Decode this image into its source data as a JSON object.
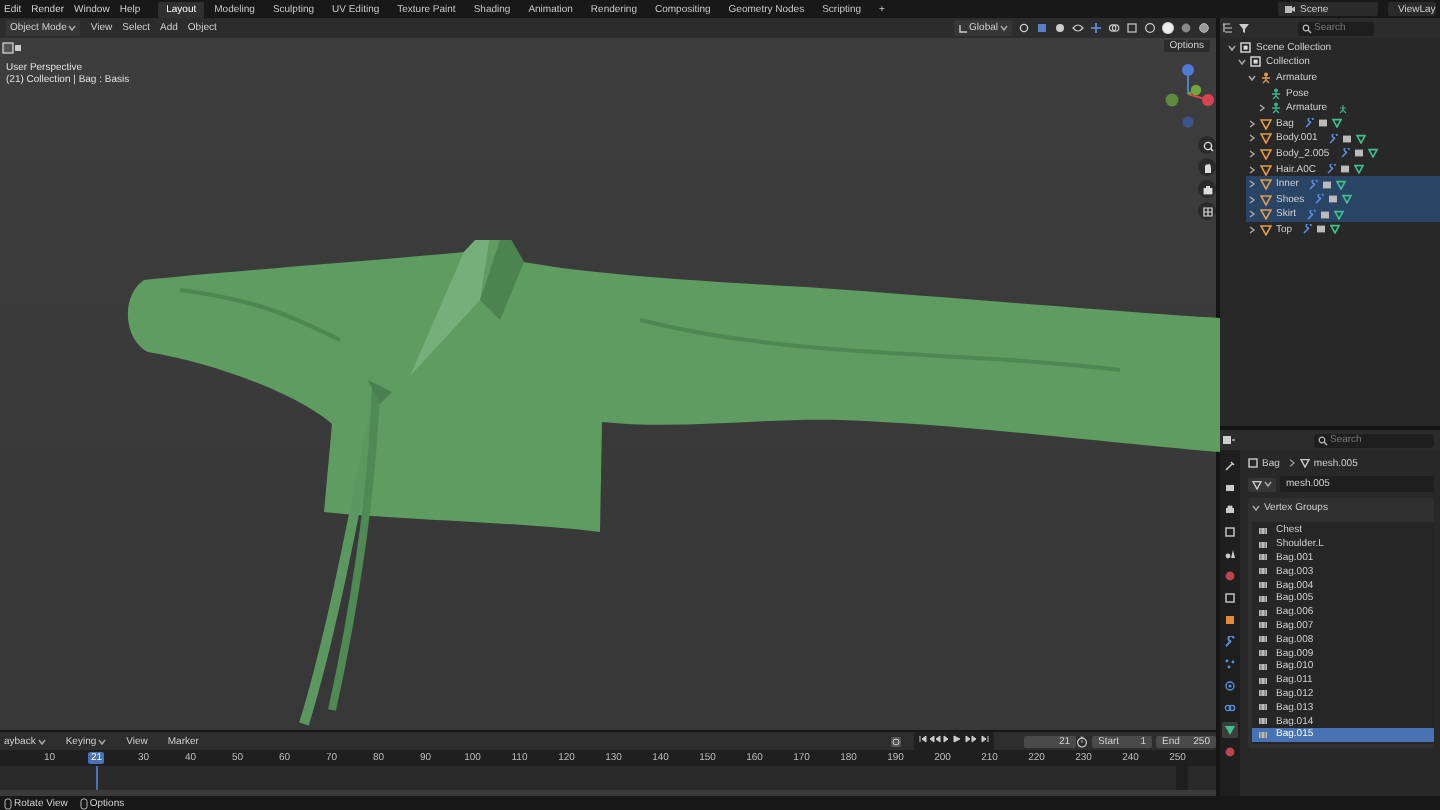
{
  "top_bar": {
    "menus": [
      "Edit",
      "Render",
      "Window",
      "Help"
    ],
    "workspaces": [
      {
        "label": "Layout",
        "selected": true
      },
      {
        "label": "Modeling",
        "selected": false
      },
      {
        "label": "Sculpting",
        "selected": false
      },
      {
        "label": "UV Editing",
        "selected": false
      },
      {
        "label": "Texture Paint",
        "selected": false
      },
      {
        "label": "Shading",
        "selected": false
      },
      {
        "label": "Animation",
        "selected": false
      },
      {
        "label": "Rendering",
        "selected": false
      },
      {
        "label": "Compositing",
        "selected": false
      },
      {
        "label": "Geometry Nodes",
        "selected": false
      },
      {
        "label": "Scripting",
        "selected": false
      }
    ],
    "add_workspace": "+",
    "scene": "Scene",
    "view_layer": "ViewLay"
  },
  "viewport": {
    "header": {
      "mode": "Object Mode",
      "menus": [
        "View",
        "Select",
        "Add",
        "Object"
      ],
      "orientation": "Global"
    },
    "options": "Options",
    "overlay_lines": [
      "User Perspective",
      "(21) Collection | Bag : Basis"
    ]
  },
  "outliner": {
    "search": {
      "placeholder": "Search"
    },
    "tree": [
      {
        "label": "Scene Collection",
        "kind": "scene",
        "selected": false,
        "expanded": true,
        "children": [
          {
            "label": "Collection",
            "kind": "collection",
            "selected": false,
            "expanded": true,
            "children": [
              {
                "label": "Armature",
                "kind": "armature",
                "selected": false,
                "expanded": true,
                "children": [
                  {
                    "label": "Pose",
                    "kind": "pose",
                    "selected": false
                  },
                  {
                    "label": "Armature",
                    "kind": "armature_data",
                    "selected": false,
                    "expanded": false
                  }
                ]
              },
              {
                "label": "Bag",
                "kind": "mesh",
                "selected": false,
                "expanded": false
              },
              {
                "label": "Body.001",
                "kind": "mesh",
                "selected": false,
                "expanded": false
              },
              {
                "label": "Body_2.005",
                "kind": "mesh",
                "selected": false,
                "expanded": false
              },
              {
                "label": "Hair.A0C",
                "kind": "mesh",
                "selected": false,
                "expanded": false
              },
              {
                "label": "Inner",
                "kind": "mesh",
                "selected": true,
                "expanded": false
              },
              {
                "label": "Shoes",
                "kind": "mesh",
                "selected": true,
                "expanded": false
              },
              {
                "label": "Skirt",
                "kind": "mesh",
                "selected": true,
                "expanded": false
              },
              {
                "label": "Top",
                "kind": "mesh",
                "selected": false,
                "expanded": false
              }
            ]
          }
        ]
      }
    ]
  },
  "properties": {
    "search": {
      "placeholder": "Search"
    },
    "tabs": [
      {
        "kind": "tool",
        "selected": false
      },
      {
        "kind": "render",
        "selected": false
      },
      {
        "kind": "output",
        "selected": false
      },
      {
        "kind": "view_layer",
        "selected": false
      },
      {
        "kind": "scene",
        "selected": false
      },
      {
        "kind": "world",
        "selected": false
      },
      {
        "kind": "collection",
        "selected": false
      },
      {
        "kind": "object",
        "selected": false
      },
      {
        "kind": "modifier",
        "selected": false
      },
      {
        "kind": "particles",
        "selected": false
      },
      {
        "kind": "physics",
        "selected": false
      },
      {
        "kind": "constraints",
        "selected": false
      },
      {
        "kind": "data",
        "selected": true
      },
      {
        "kind": "material",
        "selected": false
      }
    ],
    "breadcrumb": [
      "Bag",
      "mesh.005"
    ],
    "data_name": "mesh.005",
    "panel": {
      "title": "Vertex Groups",
      "expanded": true,
      "groups": [
        {
          "name": "Chest",
          "selected": false
        },
        {
          "name": "Shoulder.L",
          "selected": false
        },
        {
          "name": "Bag.001",
          "selected": false
        },
        {
          "name": "Bag.003",
          "selected": false
        },
        {
          "name": "Bag.004",
          "selected": false
        },
        {
          "name": "Bag.005",
          "selected": false
        },
        {
          "name": "Bag.006",
          "selected": false
        },
        {
          "name": "Bag.007",
          "selected": false
        },
        {
          "name": "Bag.008",
          "selected": false
        },
        {
          "name": "Bag.009",
          "selected": false
        },
        {
          "name": "Bag.010",
          "selected": false
        },
        {
          "name": "Bag.011",
          "selected": false
        },
        {
          "name": "Bag.012",
          "selected": false
        },
        {
          "name": "Bag.013",
          "selected": false
        },
        {
          "name": "Bag.014",
          "selected": false
        },
        {
          "name": "Bag.015",
          "selected": true
        }
      ]
    }
  },
  "timeline": {
    "menus": [
      {
        "label": "ayback",
        "dropdown": true
      },
      {
        "label": "Keying",
        "dropdown": true
      },
      {
        "label": "View",
        "dropdown": false
      },
      {
        "label": "Marker",
        "dropdown": false
      }
    ],
    "current_frame": "21",
    "start_label": "Start",
    "start": "1",
    "end_label": "End",
    "end": "250",
    "ruler": [
      {
        "label": "10",
        "kind": "tick"
      },
      {
        "label": "21",
        "kind": "current"
      },
      {
        "label": "30",
        "kind": "tick"
      },
      {
        "label": "40",
        "kind": "tick"
      },
      {
        "label": "50",
        "kind": "tick"
      },
      {
        "label": "60",
        "kind": "tick"
      },
      {
        "label": "70",
        "kind": "tick"
      },
      {
        "label": "80",
        "kind": "tick"
      },
      {
        "label": "90",
        "kind": "tick"
      },
      {
        "label": "100",
        "kind": "tick"
      },
      {
        "label": "110",
        "kind": "tick"
      },
      {
        "label": "120",
        "kind": "tick"
      },
      {
        "label": "130",
        "kind": "tick"
      },
      {
        "label": "140",
        "kind": "tick"
      },
      {
        "label": "150",
        "kind": "tick"
      },
      {
        "label": "160",
        "kind": "tick"
      },
      {
        "label": "170",
        "kind": "tick"
      },
      {
        "label": "180",
        "kind": "tick"
      },
      {
        "label": "190",
        "kind": "tick"
      },
      {
        "label": "200",
        "kind": "tick"
      },
      {
        "label": "210",
        "kind": "tick"
      },
      {
        "label": "220",
        "kind": "tick"
      },
      {
        "label": "230",
        "kind": "tick"
      },
      {
        "label": "240",
        "kind": "tick"
      },
      {
        "label": "250",
        "kind": "tick"
      }
    ]
  },
  "status_bar": {
    "items": [
      "Rotate View",
      "Options"
    ]
  }
}
